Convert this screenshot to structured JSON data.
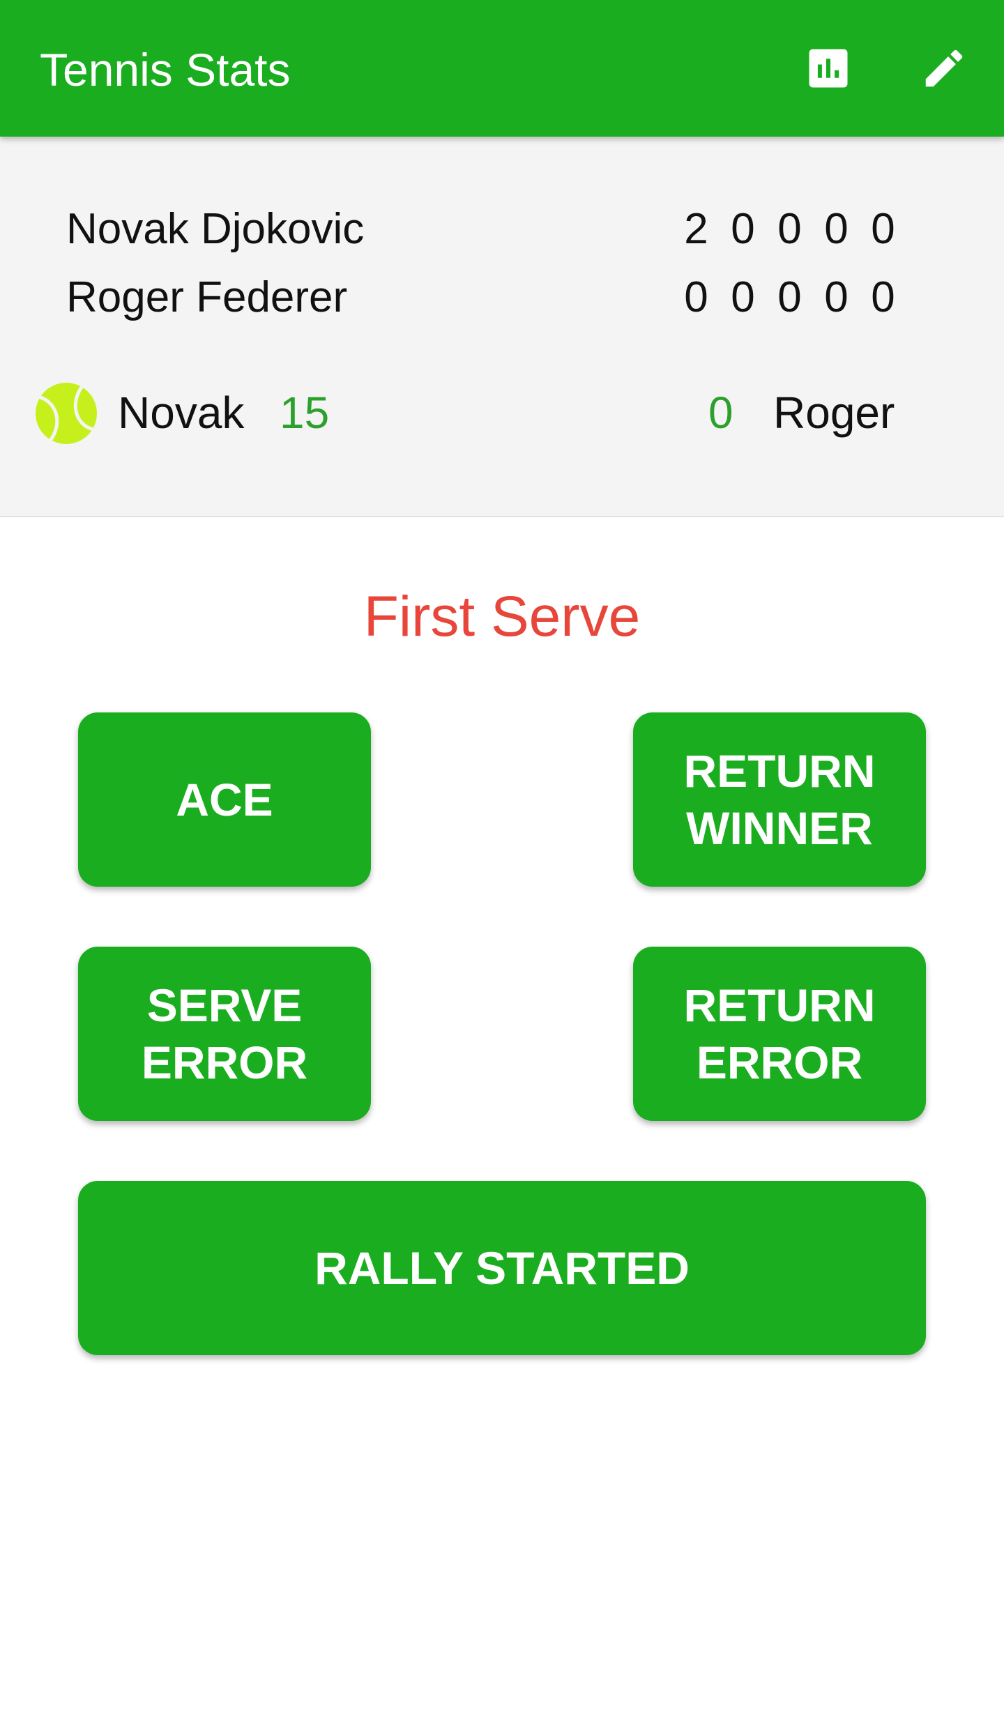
{
  "app_bar": {
    "title": "Tennis Stats",
    "stats_icon": "bar-chart-icon",
    "edit_icon": "pencil-icon",
    "background": "#1aad1f"
  },
  "scoreboard": {
    "players": [
      {
        "name": "Novak Djokovic",
        "sets": [
          "2",
          "0",
          "0",
          "0",
          "0"
        ]
      },
      {
        "name": "Roger Federer",
        "sets": [
          "0",
          "0",
          "0",
          "0",
          "0"
        ]
      }
    ],
    "current_game": {
      "server_icon": "tennis-ball-icon",
      "server_name": "Novak",
      "server_points": "15",
      "receiver_points": "0",
      "receiver_name": "Roger"
    }
  },
  "serve_status": {
    "label": "First Serve",
    "color": "#e8463a"
  },
  "actions": {
    "ace": "ACE",
    "return_winner": "RETURN\nWINNER",
    "serve_error": "SERVE\nERROR",
    "return_error": "RETURN\nERROR",
    "rally_started": "RALLY STARTED"
  }
}
